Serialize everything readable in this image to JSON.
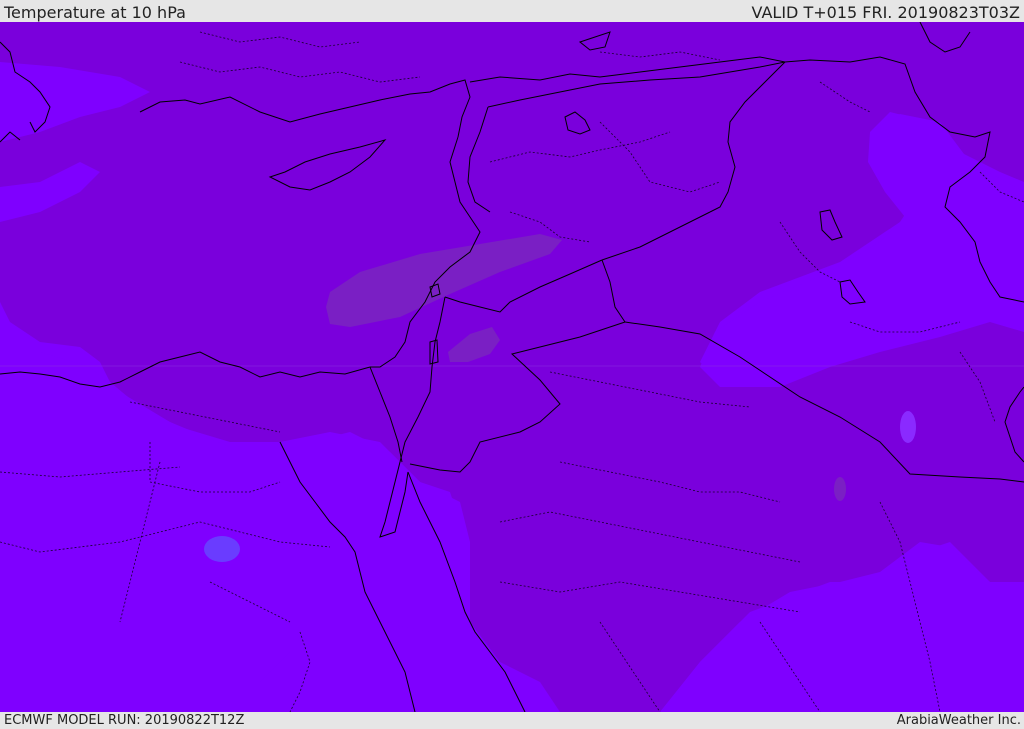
{
  "header": {
    "title": "Temperature at 10 hPa",
    "valid": "VALID T+015 FRI. 20190823T03Z"
  },
  "footer": {
    "model_run": "ECMWF MODEL RUN: 20190822T12Z",
    "credit": "ArabiaWeather Inc."
  },
  "map": {
    "field": "temperature",
    "level": "10 hPa",
    "colors": {
      "dark_violet": "#7a00dc",
      "bright_violet": "#7f00ff",
      "mauve_band": "#7a1fc4",
      "blue_blob": "#6a3cff",
      "border_line": "#000000"
    }
  }
}
